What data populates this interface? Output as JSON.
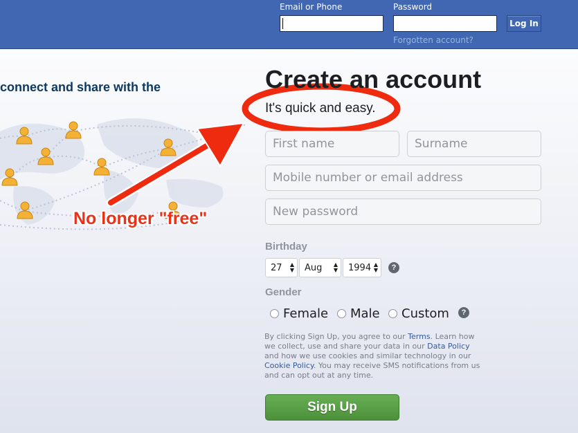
{
  "header": {
    "email_label": "Email or Phone",
    "password_label": "Password",
    "login_button": "Log In",
    "forgot_link": "Forgotten account?"
  },
  "hero": {
    "tagline": "connect and share with the",
    "annotation": "No longer \"free\""
  },
  "signup": {
    "title": "Create an account",
    "subtitle": "It's quick and easy.",
    "first_name_placeholder": "First name",
    "surname_placeholder": "Surname",
    "contact_placeholder": "Mobile number or email address",
    "password_placeholder": "New password",
    "birthday_label": "Birthday",
    "birthday": {
      "day": "27",
      "month": "Aug",
      "year": "1994"
    },
    "gender_label": "Gender",
    "gender_options": [
      "Female",
      "Male",
      "Custom"
    ],
    "help_glyph": "?",
    "legal": {
      "part1": "By clicking Sign Up, you agree to our ",
      "terms_link": "Terms",
      "part2": ". Learn how we collect, use and share your data in our ",
      "data_policy_link": "Data Policy",
      "part3": " and how we use cookies and similar technology in our ",
      "cookie_policy_link": "Cookie Policy",
      "part4": ". You may receive SMS notifications from us and can opt out at any time."
    },
    "signup_button": "Sign Up"
  },
  "icons": {
    "select_spinner": "up-down-arrows",
    "help": "question-circle-icon",
    "person": "person-icon"
  },
  "colors": {
    "topbar": "#4267b2",
    "signup_green": "#4c9139",
    "annotation_red": "#e8321a",
    "tagline_blue": "#0e385f"
  }
}
